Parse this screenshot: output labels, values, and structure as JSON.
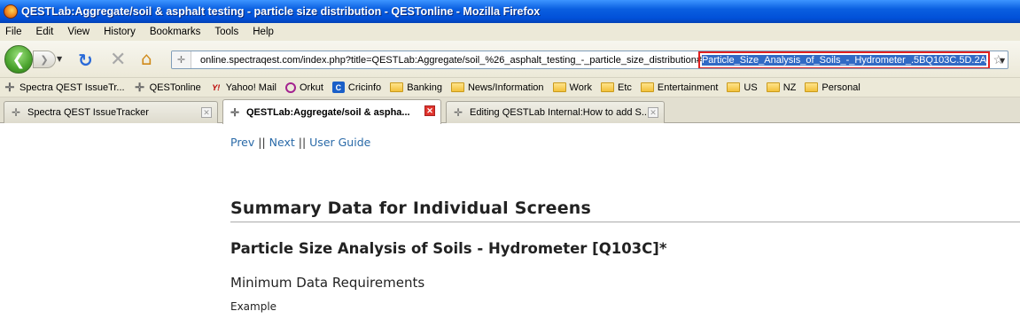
{
  "window": {
    "title": "QESTLab:Aggregate/soil & asphalt testing - particle size distribution - QESTonline - Mozilla Firefox"
  },
  "menu": [
    "File",
    "Edit",
    "View",
    "History",
    "Bookmarks",
    "Tools",
    "Help"
  ],
  "urlbar": {
    "plain": "online.spectraqest.com/index.php?title=QESTLab:Aggregate/soil_%26_asphalt_testing_-_particle_size_distribution#",
    "selected": "Particle_Size_Analysis_of_Soils_-_Hydrometer_.5BQ103C.5D.2A"
  },
  "bookmarks": [
    {
      "label": "Spectra QEST IssueTr...",
      "icon": "spectra-icon"
    },
    {
      "label": "QESTonline",
      "icon": "spectra-icon"
    },
    {
      "label": "Yahoo! Mail",
      "icon": "yahoo-icon"
    },
    {
      "label": "Orkut",
      "icon": "orkut-icon"
    },
    {
      "label": "Cricinfo",
      "icon": "cricinfo-icon"
    },
    {
      "label": "Banking",
      "icon": "folder-icon"
    },
    {
      "label": "News/Information",
      "icon": "folder-icon"
    },
    {
      "label": "Work",
      "icon": "folder-icon"
    },
    {
      "label": "Etc",
      "icon": "folder-icon"
    },
    {
      "label": "Entertainment",
      "icon": "folder-icon"
    },
    {
      "label": "US",
      "icon": "folder-icon"
    },
    {
      "label": "NZ",
      "icon": "folder-icon"
    },
    {
      "label": "Personal",
      "icon": "folder-icon"
    }
  ],
  "tabs": [
    {
      "label": "Spectra QEST IssueTracker"
    },
    {
      "label": "QESTLab:Aggregate/soil & aspha..."
    },
    {
      "label": "Editing QESTLab Internal:How to add S..."
    }
  ],
  "content": {
    "prev": "Prev",
    "sep1": " || ",
    "next": "Next",
    "sep2": " || ",
    "guide": "User Guide",
    "heading": "Summary Data for Individual Screens",
    "subheading": "Particle Size Analysis of Soils - Hydrometer [Q103C]*",
    "minimum": "Minimum Data Requirements",
    "example": "Example"
  },
  "colors": {
    "titlebar": "#0a5fe0",
    "selection": "#316ac5",
    "highlight_box": "#e02020",
    "link": "#2a6aa8"
  }
}
